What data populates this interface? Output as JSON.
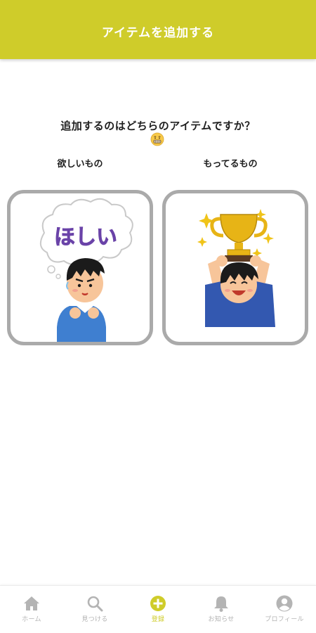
{
  "header": {
    "title": "アイテムを追加する"
  },
  "question": {
    "text": "追加するのはどちらのアイテムですか？",
    "emoji": "grimacing-face"
  },
  "options": [
    {
      "label": "欲しいもの",
      "bubble_text": "ほしい"
    },
    {
      "label": "もってるもの"
    }
  ],
  "colors": {
    "accent": "#cfcc2a",
    "card_border": "#aaaaaa",
    "tab_inactive": "#b4b4b4"
  },
  "tabs": [
    {
      "label": "ホーム",
      "icon": "home-icon",
      "active": false
    },
    {
      "label": "見つける",
      "icon": "search-icon",
      "active": false
    },
    {
      "label": "登録",
      "icon": "add-circle-icon",
      "active": true
    },
    {
      "label": "お知らせ",
      "icon": "bell-icon",
      "active": false
    },
    {
      "label": "プロフィール",
      "icon": "profile-icon",
      "active": false
    }
  ]
}
